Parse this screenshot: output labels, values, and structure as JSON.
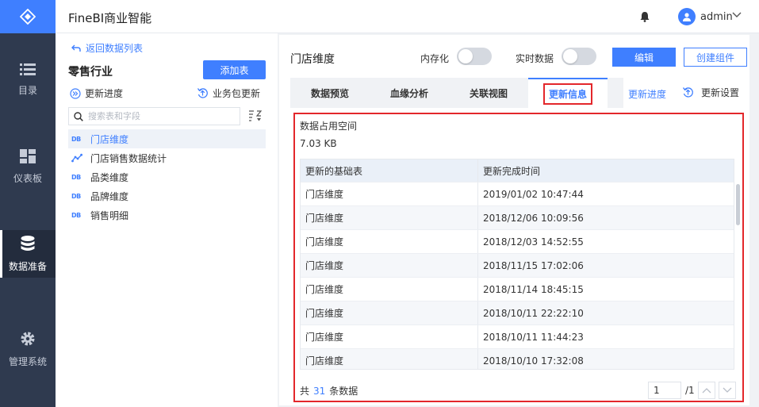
{
  "app": {
    "title": "FineBI商业智能"
  },
  "header": {
    "user_name": "admin"
  },
  "nav": {
    "items": [
      {
        "label": "目录",
        "icon": "list-icon"
      },
      {
        "label": "仪表板",
        "icon": "dashboard-icon"
      },
      {
        "label": "数据准备",
        "icon": "database-icon",
        "active": true
      },
      {
        "label": "管理系统",
        "icon": "gear-icon"
      }
    ]
  },
  "sidebar": {
    "back_label": "返回数据列表",
    "package_name": "零售行业",
    "add_table_label": "添加表",
    "update_progress_label": "更新进度",
    "package_update_label": "业务包更新",
    "search_placeholder": "搜索表和字段",
    "tables": [
      {
        "name": "门店维度",
        "type": "db",
        "active": true
      },
      {
        "name": "门店销售数据统计",
        "type": "analysis"
      },
      {
        "name": "品类维度",
        "type": "db"
      },
      {
        "name": "品牌维度",
        "type": "db"
      },
      {
        "name": "销售明细",
        "type": "db"
      }
    ]
  },
  "main": {
    "table_name": "门店维度",
    "in_memory_label": "内存化",
    "realtime_label": "实时数据",
    "edit_label": "编辑",
    "create_component_label": "创建组件",
    "tabs": [
      {
        "label": "数据预览"
      },
      {
        "label": "血缘分析"
      },
      {
        "label": "关联视图"
      },
      {
        "label": "更新信息",
        "active": true
      }
    ],
    "update_progress_link": "更新进度",
    "update_settings_label": "更新设置",
    "info": {
      "space_label": "数据占用空间",
      "space_value": "7.03 KB",
      "columns": [
        "更新的基础表",
        "更新完成时间"
      ],
      "rows": [
        [
          "门店维度",
          "2019/01/02 10:47:44"
        ],
        [
          "门店维度",
          "2018/12/06 10:09:56"
        ],
        [
          "门店维度",
          "2018/12/03 14:52:55"
        ],
        [
          "门店维度",
          "2018/11/15 17:02:06"
        ],
        [
          "门店维度",
          "2018/11/14 18:45:15"
        ],
        [
          "门店维度",
          "2018/10/11 22:22:10"
        ],
        [
          "门店维度",
          "2018/10/11 11:44:23"
        ],
        [
          "门店维度",
          "2018/10/10 17:32:08"
        ]
      ],
      "total_prefix": "共",
      "total_count": "31",
      "total_suffix": "条数据",
      "page_current": "1",
      "page_total": "/1"
    }
  },
  "colors": {
    "accent": "#3f7fff",
    "nav_bg": "#2f3a4f",
    "highlight": "#e3272b"
  }
}
